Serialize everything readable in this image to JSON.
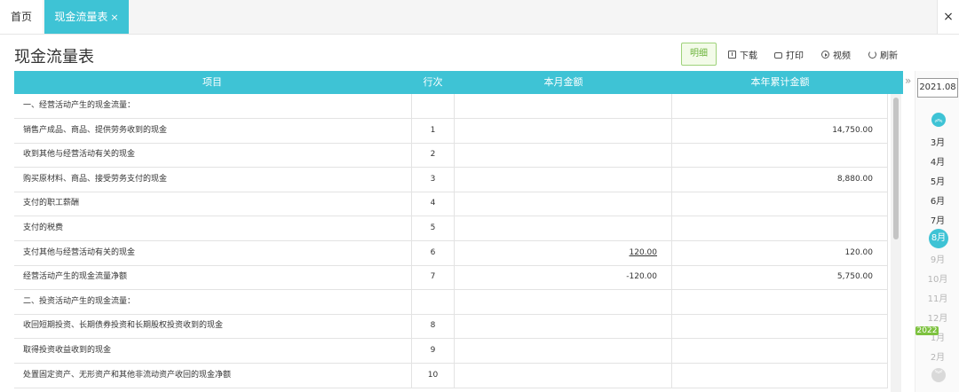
{
  "tabs": {
    "home_label": "首页",
    "active_label": "现金流量表",
    "active_close": "×",
    "window_close": "×"
  },
  "header": {
    "title": "现金流量表",
    "detail_button": "明细",
    "download": "下载",
    "print": "打印",
    "video": "视频",
    "refresh": "刷新"
  },
  "table": {
    "columns": [
      "项目",
      "行次",
      "本月金额",
      "本年累计金额"
    ],
    "rows": [
      {
        "item": "一、经营活动产生的现金流量：",
        "row": "",
        "month": "",
        "year": ""
      },
      {
        "item": "销售产成品、商品、提供劳务收到的现金",
        "row": "1",
        "month": "",
        "year": "14,750.00"
      },
      {
        "item": "收到其他与经营活动有关的现金",
        "row": "2",
        "month": "",
        "year": ""
      },
      {
        "item": "购买原材料、商品、接受劳务支付的现金",
        "row": "3",
        "month": "",
        "year": "8,880.00"
      },
      {
        "item": "支付的职工薪酬",
        "row": "4",
        "month": "",
        "year": ""
      },
      {
        "item": "支付的税费",
        "row": "5",
        "month": "",
        "year": ""
      },
      {
        "item": "支付其他与经营活动有关的现金",
        "row": "6",
        "month": "120.00",
        "year": "120.00"
      },
      {
        "item": "经营活动产生的现金流量净额",
        "row": "7",
        "month": "-120.00",
        "year": "5,750.00"
      },
      {
        "item": "二、投资活动产生的现金流量：",
        "row": "",
        "month": "",
        "year": ""
      },
      {
        "item": "收回短期投资、长期债券投资和长期股权投资收到的现金",
        "row": "8",
        "month": "",
        "year": ""
      },
      {
        "item": "取得投资收益收到的现金",
        "row": "9",
        "month": "",
        "year": ""
      },
      {
        "item": "处置固定资产、无形资产和其他非流动资产收回的现金净额",
        "row": "10",
        "month": "",
        "year": ""
      }
    ]
  },
  "date_panel": {
    "current_period": "2021.08",
    "months": [
      "3月",
      "4月",
      "5月",
      "6月",
      "7月",
      "8月",
      "9月",
      "10月",
      "11月",
      "12月",
      "1月",
      "2月"
    ],
    "current_month": "8月",
    "next_year_badge": "2022",
    "collapse_arrow": "»",
    "up_icon": "︽",
    "down_icon": "︾"
  },
  "colors": {
    "accent": "#3ec3d5",
    "green": "#7dc23f"
  }
}
